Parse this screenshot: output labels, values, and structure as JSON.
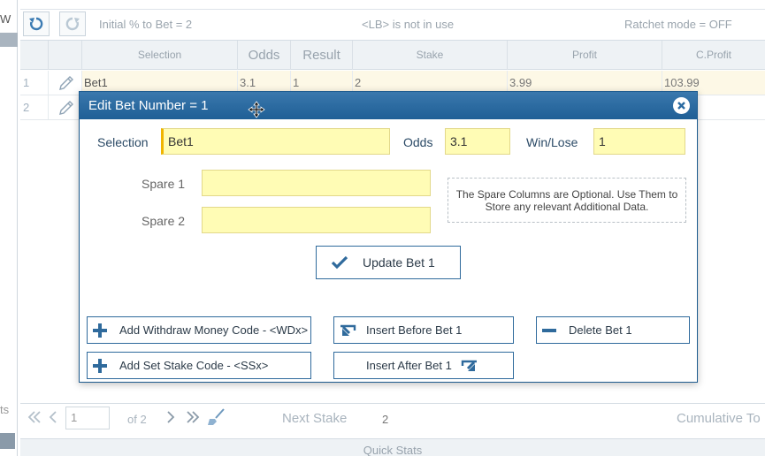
{
  "left_stub": {
    "w_text": "W",
    "ts_text": "ts"
  },
  "toolbar": {
    "initial_pct": "Initial % to Bet = 2",
    "lb_status": "<LB> is not in use",
    "ratchet": "Ratchet mode = OFF"
  },
  "grid": {
    "headers": {
      "selection": "Selection",
      "odds": "Odds",
      "result": "Result",
      "stake": "Stake",
      "profit": "Profit",
      "cprofit": "C.Profit"
    },
    "rows": [
      {
        "num": "1",
        "selection": "Bet1",
        "odds": "3.1",
        "result": "1",
        "stake": "2",
        "profit": "3.99",
        "cprofit": "103.99"
      },
      {
        "num": "2",
        "selection": "",
        "odds": "",
        "result": "",
        "stake": "",
        "profit": "",
        "cprofit": ""
      }
    ]
  },
  "pager": {
    "page_value": "1",
    "of_pages": "of 2",
    "next_stake_label": "Next Stake",
    "next_stake_value": "2",
    "cumulative_label": "Cumulative To"
  },
  "quick_stats": "Quick Stats",
  "dialog": {
    "title": "Edit Bet Number = 1",
    "selection_label": "Selection",
    "selection_value": "Bet1",
    "odds_label": "Odds",
    "odds_value": "3.1",
    "winlose_label": "Win/Lose",
    "winlose_value": "1",
    "spare1_label": "Spare 1",
    "spare1_value": "",
    "spare2_label": "Spare 2",
    "spare2_value": "",
    "note": "The Spare Columns are Optional. Use Them to Store any relevant Additional Data.",
    "update_btn": "Update Bet 1",
    "add_withdraw_btn": "Add Withdraw Money Code - <WDx>",
    "insert_before_btn": "Insert Before Bet 1",
    "delete_btn": "Delete Bet 1",
    "add_stake_btn": "Add Set Stake Code - <SSx>",
    "insert_after_btn": "Insert After Bet 1"
  },
  "colors": {
    "dialog_title_bg": "#2a6aa1",
    "field_bg": "#fffcb5",
    "accent": "#2f6a9c",
    "focus_border": "#f0b400"
  },
  "icons": {
    "undo": "undo-icon",
    "redo": "redo-icon",
    "edit": "pencil-icon",
    "close": "close-icon",
    "check": "checkmark-icon",
    "plus": "plus-icon",
    "minus": "minus-icon"
  }
}
